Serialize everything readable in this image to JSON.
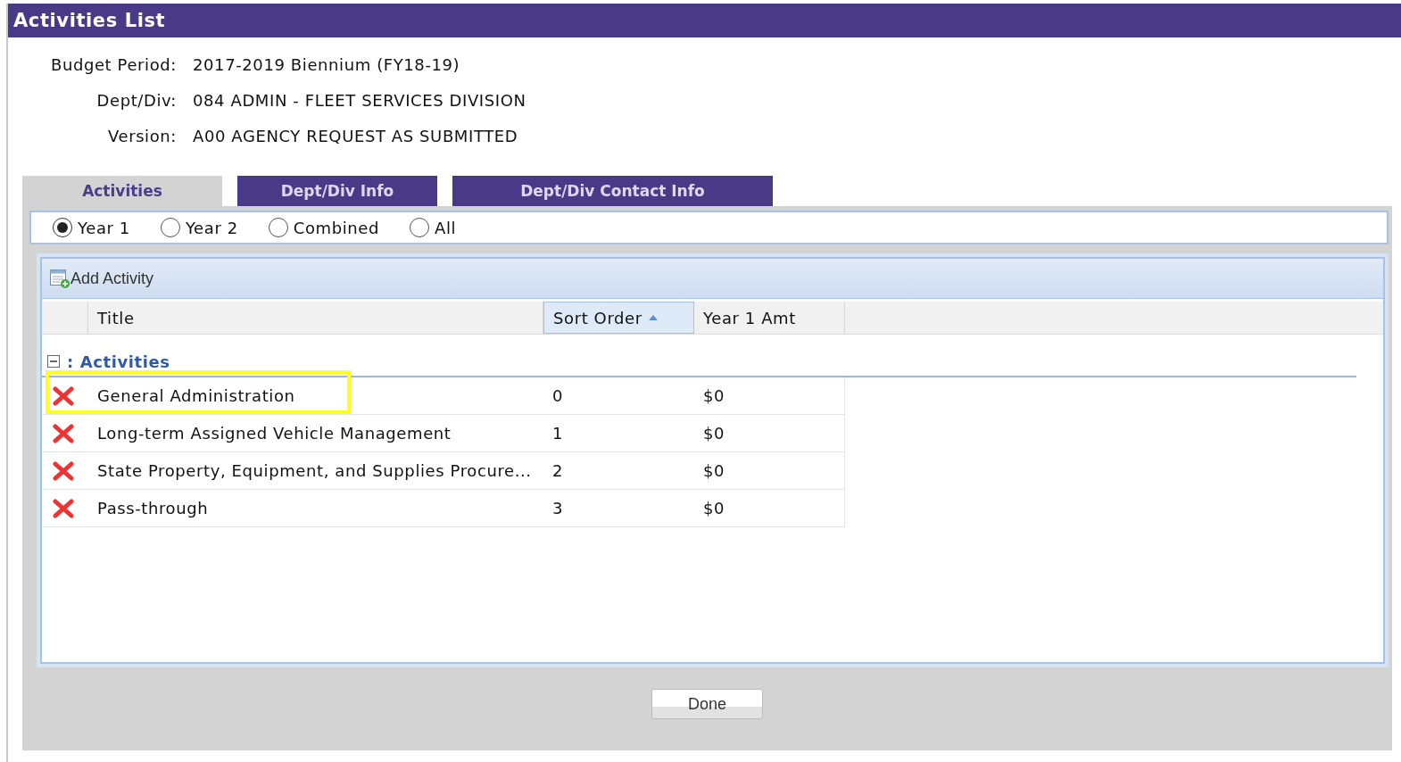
{
  "window": {
    "title": "Activities List"
  },
  "info": [
    {
      "label": "Budget Period:",
      "value": "2017-2019 Biennium (FY18-19)"
    },
    {
      "label": "Dept/Div:",
      "value": "084 ADMIN - FLEET SERVICES DIVISION"
    },
    {
      "label": "Version:",
      "value": "A00 AGENCY REQUEST AS SUBMITTED"
    }
  ],
  "tabs": [
    {
      "label": "Activities",
      "selected": true
    },
    {
      "label": "Dept/Div Info",
      "selected": false
    },
    {
      "label": "Dept/Div Contact Info",
      "selected": false
    }
  ],
  "year_options": [
    {
      "label": "Year 1",
      "selected": true
    },
    {
      "label": "Year 2",
      "selected": false
    },
    {
      "label": "Combined",
      "selected": false
    },
    {
      "label": "All",
      "selected": false
    }
  ],
  "toolbar": {
    "add_button": "Add Activity"
  },
  "table": {
    "columns": [
      {
        "label": "Title",
        "sorted": false
      },
      {
        "label": "Sort Order",
        "sorted": true
      },
      {
        "label": "Year 1 Amt",
        "sorted": false
      }
    ],
    "group": {
      "label": ": Activities",
      "expanded": true
    },
    "rows": [
      {
        "title": "General Administration",
        "sort_order": "0",
        "amount": "$0",
        "highlighted": true
      },
      {
        "title": "Long-term Assigned Vehicle Management",
        "sort_order": "1",
        "amount": "$0",
        "highlighted": false
      },
      {
        "title": "State Property, Equipment, and Supplies Procure...",
        "sort_order": "2",
        "amount": "$0",
        "highlighted": false
      },
      {
        "title": "Pass-through",
        "sort_order": "3",
        "amount": "$0",
        "highlighted": false
      }
    ]
  },
  "buttons": [
    "Done"
  ]
}
